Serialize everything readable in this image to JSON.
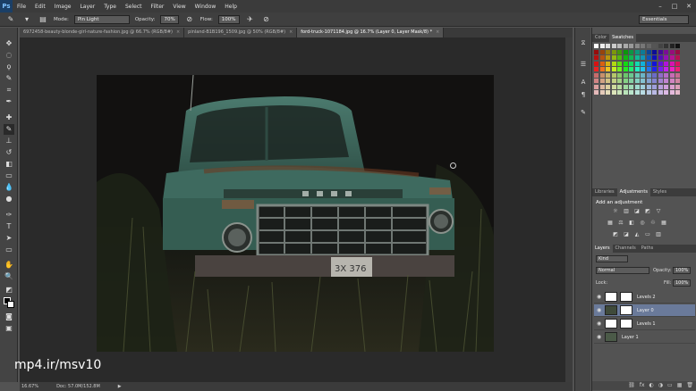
{
  "app": {
    "logo": "Ps"
  },
  "menu": [
    "File",
    "Edit",
    "Image",
    "Layer",
    "Type",
    "Select",
    "Filter",
    "View",
    "Window",
    "Help"
  ],
  "window_controls": [
    "–",
    "□",
    "✕"
  ],
  "options_bar": {
    "tool_icon": "brush-icon",
    "mode_label": "Mode:",
    "mode_value": "Pin Light",
    "opacity_label": "Opacity:",
    "opacity_value": "70%",
    "flow_label": "Flow:",
    "flow_value": "100%",
    "workspace": "Essentials"
  },
  "doc_tabs": [
    {
      "label": "6972458-beauty-blonde-girl-nature-fashion.jpg @ 66.7% (RGB/8#)",
      "active": false
    },
    {
      "label": "pinland-B1B196_1509.jpg @ 50% (RGB/8#)",
      "active": false
    },
    {
      "label": "ford-truck-1071184.jpg @ 16.7% (Layer 0, Layer Mask/8) *",
      "active": true
    }
  ],
  "tab_close": "×",
  "status": {
    "zoom": "16.67%",
    "doc": "Doc: 57.0M/152.8M"
  },
  "watermark": "mp4.ir/msv10",
  "color_panel": {
    "tabs": [
      "Color",
      "Swatches"
    ]
  },
  "adjust_panel": {
    "tabs": [
      "Libraries",
      "Adjustments",
      "Styles"
    ],
    "title": "Add an adjustment"
  },
  "layers_panel": {
    "tabs": [
      "Layers",
      "Channels",
      "Paths"
    ],
    "kind": "Kind",
    "blend": "Normal",
    "opacity_label": "Opacity:",
    "opacity_value": "100%",
    "lock_label": "Lock:",
    "fill_label": "Fill:",
    "fill_value": "100%",
    "layers": [
      {
        "name": "Levels 2",
        "selected": false,
        "thumb": "#ffffff"
      },
      {
        "name": "Layer 0",
        "selected": true,
        "thumb": "#3f4a3a"
      },
      {
        "name": "Levels 1",
        "selected": false,
        "thumb": "#ffffff"
      },
      {
        "name": "Layer 1",
        "selected": false,
        "thumb": "#4b5a48"
      }
    ],
    "footer_icons": [
      "⛓",
      "fx",
      "◐",
      "◑",
      "▭",
      "▦",
      "🗑"
    ]
  },
  "colors": {
    "menubar": "#3b3b3b",
    "panel": "#535353",
    "selected_layer": "#6a7a9a",
    "truck": "#3e6a5f"
  }
}
